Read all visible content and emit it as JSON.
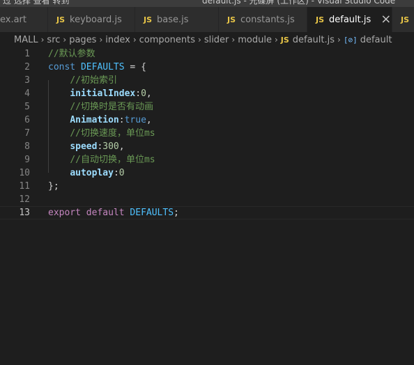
{
  "titlebar": {
    "left_text": "过 选择 查看 转到",
    "center_text": "default.js - 光碟屏 (工作区) - Visual Studio Code"
  },
  "tabs": [
    {
      "label": "ex.art",
      "icon": "",
      "active": false
    },
    {
      "label": "keyboard.js",
      "icon": "JS",
      "active": false
    },
    {
      "label": "base.js",
      "icon": "JS",
      "active": false
    },
    {
      "label": "constants.js",
      "icon": "JS",
      "active": false
    },
    {
      "label": "default.js",
      "icon": "JS",
      "active": true,
      "close": "×"
    },
    {
      "label": "",
      "icon": "JS",
      "active": false
    }
  ],
  "breadcrumb": {
    "items": [
      "MALL",
      "src",
      "pages",
      "index",
      "components",
      "slider",
      "module"
    ],
    "file_icon": "JS",
    "file": "default.js",
    "symbol_icon": "[⊘]",
    "symbol": "default"
  },
  "editor": {
    "current_line": 13,
    "lines": [
      {
        "num": "1",
        "tokens": [
          {
            "t": "//默认参数",
            "c": "comment"
          }
        ]
      },
      {
        "num": "2",
        "tokens": [
          {
            "t": "const ",
            "c": "kw"
          },
          {
            "t": "DEFAULTS",
            "c": "const"
          },
          {
            "t": " = {",
            "c": "punc"
          }
        ]
      },
      {
        "num": "3",
        "tokens": [
          {
            "t": "    ",
            "c": "punc"
          },
          {
            "t": "//初始索引",
            "c": "comment"
          }
        ]
      },
      {
        "num": "4",
        "tokens": [
          {
            "t": "    ",
            "c": "punc"
          },
          {
            "t": "initialIndex",
            "c": "prop"
          },
          {
            "t": ":",
            "c": "punc"
          },
          {
            "t": "0",
            "c": "num"
          },
          {
            "t": ",",
            "c": "punc"
          }
        ]
      },
      {
        "num": "5",
        "tokens": [
          {
            "t": "    ",
            "c": "punc"
          },
          {
            "t": "//切换时是否有动画",
            "c": "comment"
          }
        ]
      },
      {
        "num": "6",
        "tokens": [
          {
            "t": "    ",
            "c": "punc"
          },
          {
            "t": "Animation",
            "c": "prop"
          },
          {
            "t": ":",
            "c": "punc"
          },
          {
            "t": "true",
            "c": "kw"
          },
          {
            "t": ",",
            "c": "punc"
          }
        ]
      },
      {
        "num": "7",
        "tokens": [
          {
            "t": "    ",
            "c": "punc"
          },
          {
            "t": "//切换速度，单位ms",
            "c": "comment"
          }
        ]
      },
      {
        "num": "8",
        "tokens": [
          {
            "t": "    ",
            "c": "punc"
          },
          {
            "t": "speed",
            "c": "prop"
          },
          {
            "t": ":",
            "c": "punc"
          },
          {
            "t": "300",
            "c": "num"
          },
          {
            "t": ",",
            "c": "punc"
          }
        ]
      },
      {
        "num": "9",
        "tokens": [
          {
            "t": "    ",
            "c": "punc"
          },
          {
            "t": "//自动切换，单位ms",
            "c": "comment"
          }
        ]
      },
      {
        "num": "10",
        "tokens": [
          {
            "t": "    ",
            "c": "punc"
          },
          {
            "t": "autoplay",
            "c": "prop"
          },
          {
            "t": ":",
            "c": "punc"
          },
          {
            "t": "0",
            "c": "num"
          }
        ]
      },
      {
        "num": "11",
        "tokens": [
          {
            "t": "};",
            "c": "punc"
          }
        ]
      },
      {
        "num": "12",
        "tokens": []
      },
      {
        "num": "13",
        "tokens": [
          {
            "t": "export ",
            "c": "ctrl"
          },
          {
            "t": "default ",
            "c": "ctrl"
          },
          {
            "t": "DEFAULTS",
            "c": "const"
          },
          {
            "t": ";",
            "c": "punc"
          }
        ]
      }
    ]
  },
  "colors": {
    "background": "#1e1e1e",
    "tab_inactive": "#2d2d2d",
    "js_icon": "#e8c547",
    "comment": "#6a9955",
    "keyword": "#569cd6",
    "constant": "#4fc1ff",
    "property": "#9cdcfe",
    "number": "#b5cea8"
  }
}
